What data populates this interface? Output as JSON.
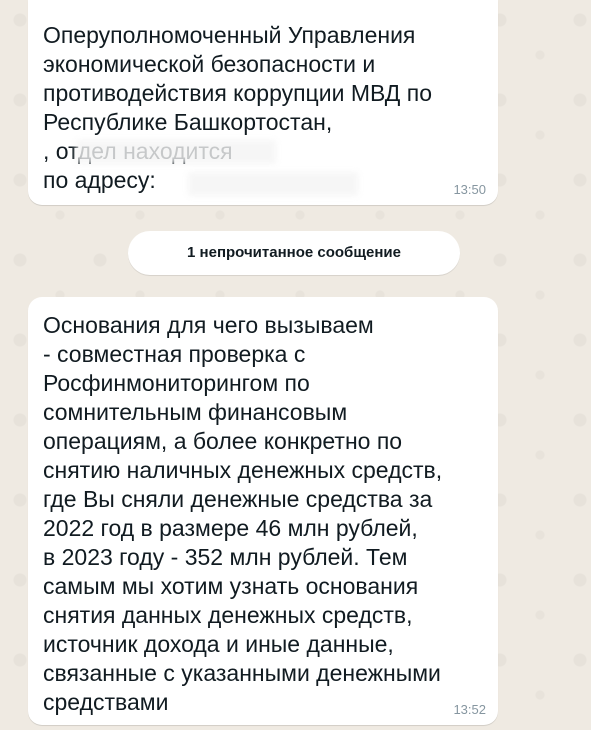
{
  "chat": {
    "messages": [
      {
        "text": "Оперуполномоченный Управления\nэкономической безопасности и\nпротиводействия коррупции МВД по\nРеспублике Башкортостан,\n                              , отдел находится\nпо адресу:",
        "time": "13:50"
      },
      {
        "text": "Основания для чего вызываем\n- совместная проверка с\nРосфинмониторингом по\nсомнительным финансовым\nоперациям, а более конкретно по\nснятию наличных денежных средств,\nгде Вы сняли денежные средства за\n2022 год в размере 46 млн рублей,\nв 2023 году - 352 млн рублей. Тем\nсамым мы хотим узнать основания\nснятия данных денежных средств,\nисточник дохода и иные данные,\nсвязанные с указанными денежными\nсредствами",
        "time": "13:52"
      }
    ],
    "unread_banner": "1 непрочитанное сообщение"
  }
}
